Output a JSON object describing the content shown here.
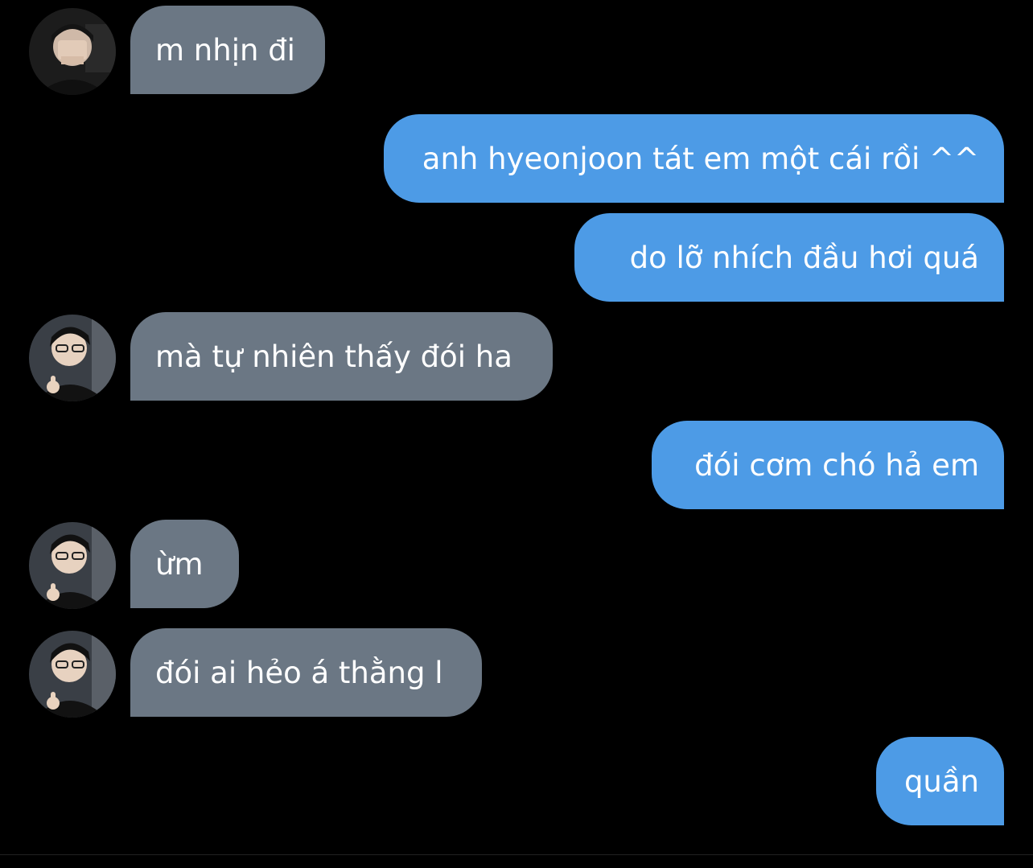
{
  "chat": {
    "messages": [
      {
        "direction": "in",
        "text": "m nhịn đi",
        "avatar": "avatar-hand-over-face"
      },
      {
        "direction": "out",
        "text": "anh hyeonjoon tát em một cái rồi ^^"
      },
      {
        "direction": "out",
        "text": "do lỡ nhích đầu hơi quá"
      },
      {
        "direction": "in",
        "text": "mà tự nhiên thấy đói ha",
        "avatar": "avatar-thumbs-up"
      },
      {
        "direction": "out",
        "text": "đói cơm chó hả em"
      },
      {
        "direction": "in",
        "text": "ừm",
        "avatar": "avatar-thumbs-up"
      },
      {
        "direction": "in",
        "text": "đói ai hẻo á thằng l",
        "avatar": "avatar-thumbs-up"
      },
      {
        "direction": "out",
        "text": "quần"
      }
    ]
  },
  "colors": {
    "background": "#000000",
    "incoming_bubble": "#6b7784",
    "outgoing_bubble": "#4d9be6",
    "text": "#ffffff"
  }
}
